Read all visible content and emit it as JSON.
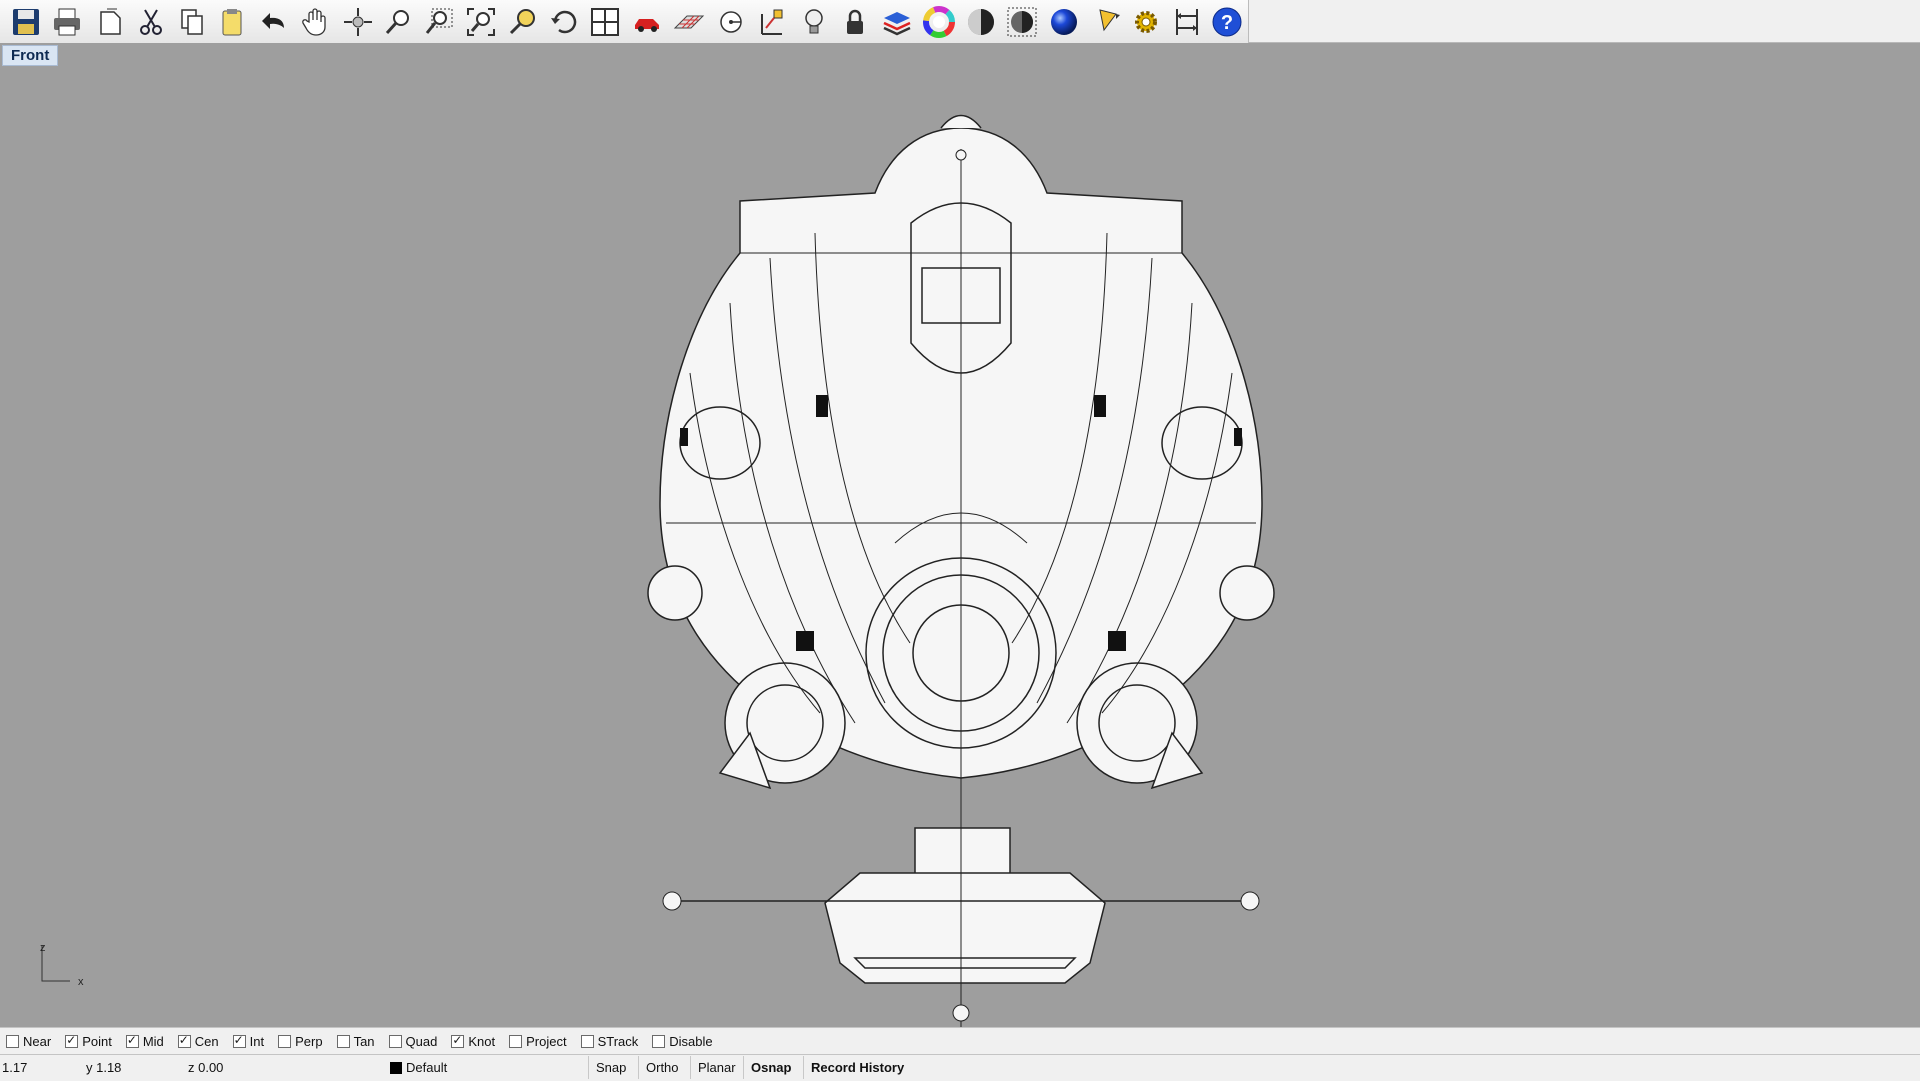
{
  "viewport": {
    "title": "Front",
    "axis": {
      "z": "z",
      "x": "x"
    }
  },
  "toolbar": {
    "buttons": [
      "save-icon",
      "print-icon",
      "new-sheet-icon",
      "cut-icon",
      "copy-icon",
      "paste-icon",
      "undo-icon",
      "pan-hand-icon",
      "rotate-view-icon",
      "zoom-icon",
      "zoom-window-icon",
      "zoom-extents-icon",
      "zoom-selected-icon",
      "undo-view-icon",
      "four-viewports-icon",
      "car-icon",
      "grid-icon",
      "point-icon",
      "gumball-icon",
      "light-bulb-icon",
      "lock-icon",
      "layers-icon",
      "color-wheel-icon",
      "shade-icon",
      "render-preview-icon",
      "render-sphere-icon",
      "pencil-icon",
      "options-gear-icon",
      "dimension-icon",
      "help-icon"
    ]
  },
  "osnap": {
    "items": [
      {
        "label": "Near",
        "checked": false
      },
      {
        "label": "Point",
        "checked": true
      },
      {
        "label": "Mid",
        "checked": true
      },
      {
        "label": "Cen",
        "checked": true
      },
      {
        "label": "Int",
        "checked": true
      },
      {
        "label": "Perp",
        "checked": false
      },
      {
        "label": "Tan",
        "checked": false
      },
      {
        "label": "Quad",
        "checked": false
      },
      {
        "label": "Knot",
        "checked": true
      },
      {
        "label": "Project",
        "checked": false
      },
      {
        "label": "STrack",
        "checked": false
      },
      {
        "label": "Disable",
        "checked": false
      }
    ]
  },
  "status": {
    "x": "1.17",
    "y": "y 1.18",
    "z": "z 0.00",
    "layer": "Default",
    "snap": "Snap",
    "ortho": "Ortho",
    "planar": "Planar",
    "osnap": "Osnap",
    "record_history": "Record History"
  },
  "colors": {
    "viewport_bg": "#9e9e9e",
    "title_bg": "#d9e5f3",
    "help_blue": "#1f4fd6"
  }
}
